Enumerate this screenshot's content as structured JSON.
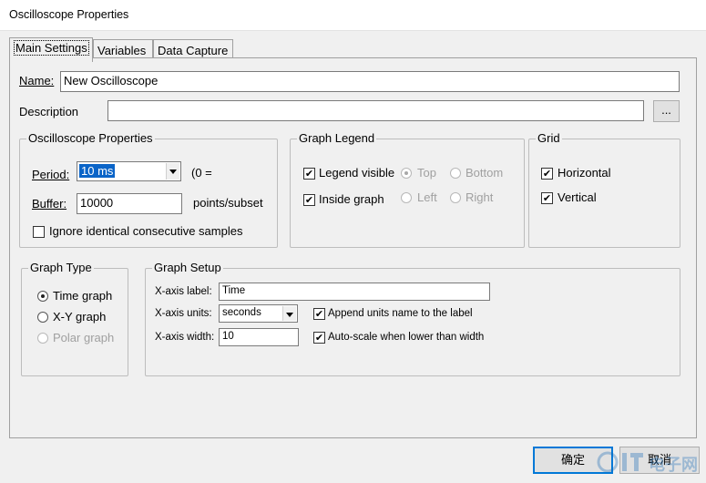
{
  "window": {
    "title": "Oscilloscope Properties"
  },
  "tabs": [
    {
      "label": "Main Settings",
      "active": true
    },
    {
      "label": "Variables",
      "active": false
    },
    {
      "label": "Data Capture",
      "active": false
    }
  ],
  "main": {
    "name_label": "Name:",
    "name_value": "New Oscilloscope",
    "description_label": "Description",
    "description_value": "",
    "browse_label": "..."
  },
  "osc_props": {
    "title": "Oscilloscope Properties",
    "period_label": "Period:",
    "period_value": "10 ms",
    "period_hint": "(0 =",
    "buffer_label": "Buffer:",
    "buffer_value": "10000",
    "buffer_unit": "points/subset",
    "ignore_label": "Ignore identical consecutive samples",
    "ignore_checked": false
  },
  "graph_legend": {
    "title": "Graph Legend",
    "legend_visible_label": "Legend visible",
    "legend_visible_checked": true,
    "top_label": "Top",
    "bottom_label": "Bottom",
    "inside_graph_label": "Inside graph",
    "inside_graph_checked": true,
    "left_label": "Left",
    "right_label": "Right"
  },
  "grid": {
    "title": "Grid",
    "horizontal_label": "Horizontal",
    "horizontal_checked": true,
    "vertical_label": "Vertical",
    "vertical_checked": true
  },
  "graph_type": {
    "title": "Graph Type",
    "options": [
      {
        "label": "Time graph",
        "selected": true,
        "enabled": true
      },
      {
        "label": "X-Y graph",
        "selected": false,
        "enabled": true
      },
      {
        "label": "Polar graph",
        "selected": false,
        "enabled": false
      }
    ]
  },
  "graph_setup": {
    "title": "Graph Setup",
    "xlabel_label": "X-axis label:",
    "xlabel_value": "Time",
    "xunits_label": "X-axis units:",
    "xunits_value": "seconds",
    "append_units_label": "Append units name to the label",
    "append_units_checked": true,
    "xwidth_label": "X-axis width:",
    "xwidth_value": "10",
    "autoscale_label": "Auto-scale when lower than width",
    "autoscale_checked": true
  },
  "buttons": {
    "ok_label": "确定",
    "cancel_label": "取消"
  },
  "watermark": {
    "text": "电子网"
  },
  "icons": {
    "check": "check-mark-icon",
    "dropdown": "chevron-down-icon",
    "radio": "radio-dot-icon"
  },
  "colors": {
    "selection": "#0a64c8",
    "default_button_border": "#0078d7",
    "window_bg": "#f0f0f0"
  }
}
